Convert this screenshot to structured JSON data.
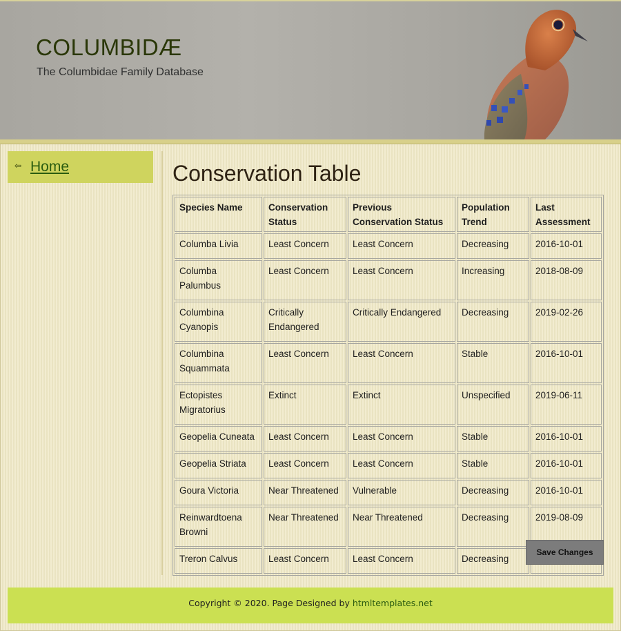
{
  "header": {
    "title": "COLUMBIDÆ",
    "subtitle": "The Columbidae Family Database"
  },
  "sidebar": {
    "items": [
      {
        "label": "Home",
        "icon": "arrow-left-icon"
      }
    ]
  },
  "main": {
    "title": "Conservation Table",
    "table": {
      "columns": [
        "Species Name",
        "Conservation Status",
        "Previous Conservation Status",
        "Population Trend",
        "Last Assessment"
      ],
      "rows": [
        [
          "Columba Livia",
          "Least Concern",
          "Least Concern",
          "Decreasing",
          "2016-10-01"
        ],
        [
          "Columba Palumbus",
          "Least Concern",
          "Least Concern",
          "Increasing",
          "2018-08-09"
        ],
        [
          "Columbina Cyanopis",
          "Critically Endangered",
          "Critically Endangered",
          "Decreasing",
          "2019-02-26"
        ],
        [
          "Columbina Squammata",
          "Least Concern",
          "Least Concern",
          "Stable",
          "2016-10-01"
        ],
        [
          "Ectopistes Migratorius",
          "Extinct",
          "Extinct",
          "Unspecified",
          "2019-06-11"
        ],
        [
          "Geopelia Cuneata",
          "Least Concern",
          "Least Concern",
          "Stable",
          "2016-10-01"
        ],
        [
          "Geopelia Striata",
          "Least Concern",
          "Least Concern",
          "Stable",
          "2016-10-01"
        ],
        [
          "Goura Victoria",
          "Near Threatened",
          "Vulnerable",
          "Decreasing",
          "2016-10-01"
        ],
        [
          "Reinwardtoena Browni",
          "Near Threatened",
          "Near Threatened",
          "Decreasing",
          "2019-08-09"
        ],
        [
          "Treron Calvus",
          "Least Concern",
          "Least Concern",
          "Decreasing",
          "2016-10-01"
        ]
      ]
    },
    "save_label": "Save Changes"
  },
  "footer": {
    "text": "Copyright © 2020. Page Designed by ",
    "link": "htmltemplates.net"
  },
  "colors": {
    "page_bg": "#efe8c6",
    "sidebar_bg": "#cfd45e",
    "footer_bg": "#cbe052",
    "title_text": "#2a3708",
    "link": "#2a5c10",
    "button_bg": "#7c7c7c"
  }
}
